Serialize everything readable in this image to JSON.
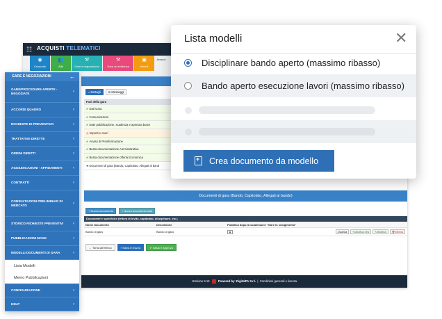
{
  "app": {
    "logo_prefix": "ACQUISTI",
    "logo_suffix": "TELEMATICI",
    "toolbar": [
      {
        "label": "Cruscotto",
        "color": "#1e86c8",
        "icon": "dashboard-icon",
        "glyph": "◉"
      },
      {
        "label": "Albi",
        "color": "#3fae49",
        "icon": "users-icon",
        "glyph": "👥"
      },
      {
        "label": "Gare e negoziazioni",
        "color": "#28b1b3",
        "icon": "gavel-icon",
        "glyph": "⚒"
      },
      {
        "label": "Gare ad evidenza",
        "color": "#e84a7c",
        "icon": "gavel-icon",
        "glyph": "⚒"
      },
      {
        "label": "Moduli",
        "color": "#f39c12",
        "icon": "box-icon",
        "glyph": "▣"
      },
      {
        "label": "Area m",
        "color": "",
        "icon": "",
        "glyph": ""
      }
    ],
    "tabs": [
      "Dettagli",
      "Messaggi"
    ],
    "checklist": {
      "header": "Fasi della gara",
      "rows": [
        {
          "label": "Dati Gara",
          "status": "ok"
        },
        {
          "label": "Comunicazioni",
          "status": "ok"
        },
        {
          "label": "Date pubblicazione, scadenza e apertura buste",
          "status": "ok"
        },
        {
          "label": "Importi e oneri",
          "status": "warn"
        },
        {
          "label": "Avviso di Preinformazione",
          "status": "ok"
        },
        {
          "label": "Busta documentazione Amministrativa",
          "status": "ok"
        },
        {
          "label": "Busta documentazione offerta Economica",
          "status": "ok"
        },
        {
          "label": "Documenti di gara (Bando, Capitolato, Allegati al band",
          "status": "current"
        }
      ]
    },
    "docs": {
      "title": "Documenti di gara (Bando, Capitolato, Allegati al bando)",
      "new_doc_button": "+ Nuovo documento",
      "new_doc_button2": "+ Nuovo documento web",
      "table_title": "Documenti e specifiche (lettera di invito, capitolato, disciplinare, etc.)",
      "columns": [
        "Nome documento",
        "Descrizione",
        "Pubblica dopo la scadenza in \"Gare in svolgimento\""
      ],
      "rows": [
        {
          "name": "Bando di gara",
          "description": "Bando di gara"
        }
      ],
      "row_actions": [
        "Scarica",
        "Modifica new",
        "Modifica",
        "Elimina"
      ]
    },
    "actions": {
      "back": "Torna all'elenco",
      "save_draft": "Salva in bozza",
      "save_approve": "Salva e Approva"
    },
    "footer": {
      "version": "Versione 9.10",
      "powered": "Powered by: DigitalPA S.r.l.",
      "links": "Condizioni generali e licenza"
    }
  },
  "sidebar": {
    "header": "GARE E NEGOZIAZIONI",
    "items": [
      "GARE/PROCEDURE APERTE - NEGOZIATE",
      "ACCORDI QUADRO",
      "RICHIESTE DI PREVENTIVO",
      "TRATTATIVE DIRETTE",
      "ORDINI DIRETTI",
      "AGGIUDICAZIONI - AFFIDAMENTI",
      "CONTRATTI",
      "CONSULTAZIONI PRELIMINARI DI MERCATO",
      "STORICO RICHIESTE PREVENTIVI",
      "PUBBLICAZIONI MAGE",
      "MODELLI DOCUMENTI DI GARA"
    ],
    "subitems": [
      "Lista Modelli",
      "Memo Pubblicazioni"
    ],
    "bottom_items": [
      "CONFIGURAZIONE",
      "HELP"
    ]
  },
  "modal": {
    "title": "Lista modelli",
    "options": [
      {
        "label": "Disciplinare bando aperto (massimo ribasso)",
        "checked": true
      },
      {
        "label": "Bando aperto esecuzione lavori (massimo ribasso)",
        "checked": false
      }
    ],
    "create_button": "Crea documento da modello"
  }
}
